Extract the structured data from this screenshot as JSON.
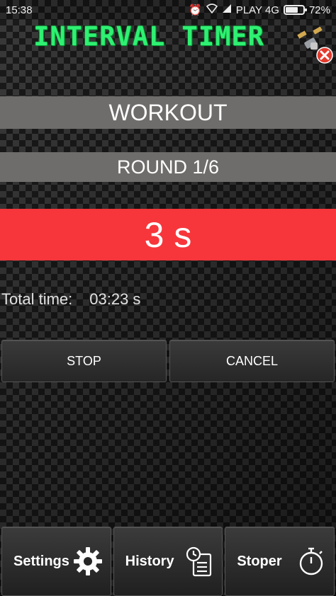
{
  "status_bar": {
    "time": "15:38",
    "carrier": "PLAY 4G",
    "battery": "72%",
    "battery_level": 0.72,
    "icons": [
      "alarm-icon",
      "wifi-icon",
      "signal-icon",
      "battery-icon"
    ]
  },
  "header": {
    "title": "INTERVAL TIMER",
    "title_color": "#2ff072",
    "exit_icon": "satellite-close-icon"
  },
  "timer": {
    "phase": "WORKOUT",
    "round": "ROUND 1/6",
    "countdown": "3 s",
    "countdown_color": "#f7363b",
    "total_label": "Total time:",
    "total_value": "03:23 s"
  },
  "actions": {
    "stop": "STOP",
    "cancel": "CANCEL"
  },
  "nav": {
    "settings": "Settings",
    "history": "History",
    "stoper": "Stoper",
    "icons": [
      "gear-icon",
      "history-clock-icon",
      "stopwatch-icon"
    ]
  }
}
